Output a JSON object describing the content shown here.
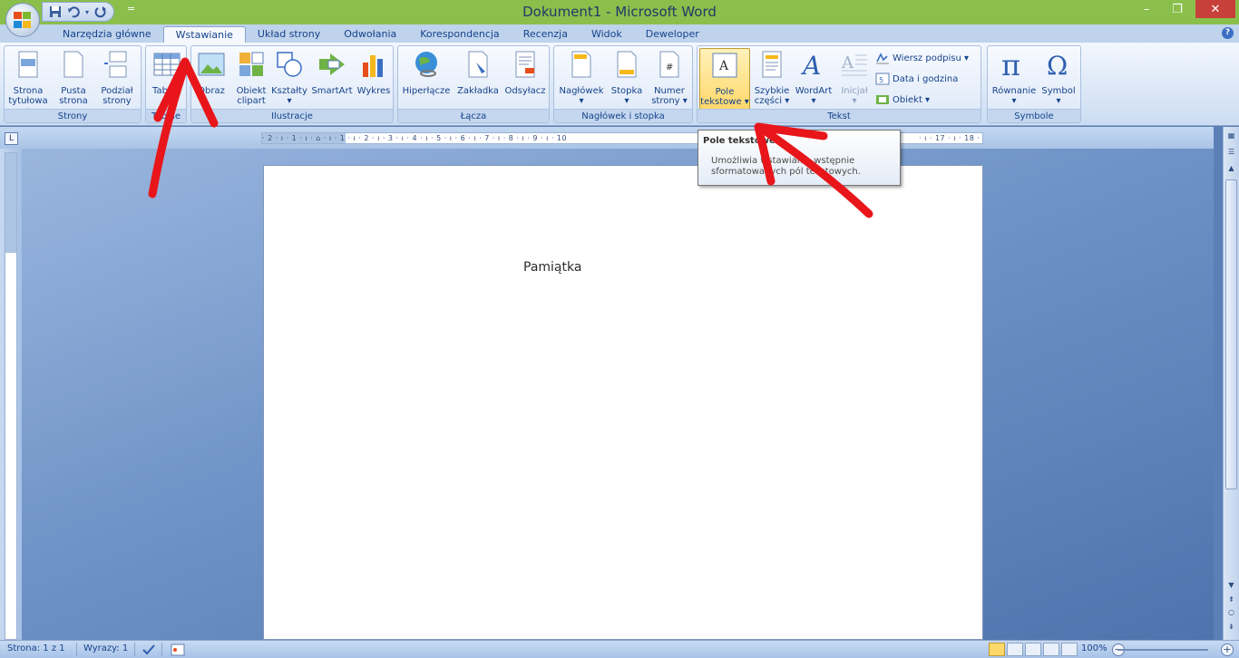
{
  "window": {
    "title": "Dokument1 - Microsoft Word",
    "qat_more": "="
  },
  "tabs": [
    {
      "label": "Narzędzia główne"
    },
    {
      "label": "Wstawianie"
    },
    {
      "label": "Układ strony"
    },
    {
      "label": "Odwołania"
    },
    {
      "label": "Korespondencja"
    },
    {
      "label": "Recenzja"
    },
    {
      "label": "Widok"
    },
    {
      "label": "Deweloper"
    }
  ],
  "ribbon": {
    "strony": {
      "label": "Strony",
      "buttons": [
        {
          "line1": "Strona",
          "line2": "tytułowa ▾"
        },
        {
          "line1": "Pusta",
          "line2": "strona"
        },
        {
          "line1": "Podział",
          "line2": "strony"
        }
      ]
    },
    "tabele": {
      "label": "Tabele",
      "button": {
        "line1": "Tabela",
        "line2": "▾"
      }
    },
    "ilustracje": {
      "label": "Ilustracje",
      "buttons": [
        {
          "line1": "Obraz",
          "line2": ""
        },
        {
          "line1": "Obiekt",
          "line2": "clipart"
        },
        {
          "line1": "Kształty",
          "line2": "▾"
        },
        {
          "line1": "SmartArt",
          "line2": ""
        },
        {
          "line1": "Wykres",
          "line2": ""
        }
      ]
    },
    "lacza": {
      "label": "Łącza",
      "buttons": [
        {
          "line1": "Hiperłącze"
        },
        {
          "line1": "Zakładka"
        },
        {
          "line1": "Odsyłacz"
        }
      ]
    },
    "naglowek": {
      "label": "Nagłówek i stopka",
      "buttons": [
        {
          "line1": "Nagłówek",
          "line2": "▾"
        },
        {
          "line1": "Stopka",
          "line2": "▾"
        },
        {
          "line1": "Numer",
          "line2": "strony ▾"
        }
      ]
    },
    "tekst": {
      "label": "Tekst",
      "buttons": [
        {
          "line1": "Pole",
          "line2": "tekstowe ▾"
        },
        {
          "line1": "Szybkie",
          "line2": "części ▾"
        },
        {
          "line1": "WordArt",
          "line2": "▾"
        },
        {
          "line1": "Inicjał",
          "line2": "▾"
        }
      ],
      "small": [
        {
          "label": "Wiersz podpisu ▾"
        },
        {
          "label": "Data i godzina"
        },
        {
          "label": "Obiekt ▾"
        }
      ]
    },
    "symbole": {
      "label": "Symbole",
      "buttons": [
        {
          "line1": "Równanie",
          "line2": "▾"
        },
        {
          "line1": "Symbol",
          "line2": "▾"
        }
      ]
    }
  },
  "ruler": {
    "ticks": "· 2 · ı · 1 · ı · ⌂ · ı · 1 · ı · 2 · ı · 3 · ı · 4 · ı · 5 · ı · 6 · ı · 7 · ı · 8 · ı · 9 · ı · 10",
    "ticks_right": "· ı · 17 · ı · 18 ·",
    "corner": "L"
  },
  "tooltip": {
    "title": "Pole tekstowe",
    "body": "Umożliwia wstawianie wstępnie sformatowanych pól tekstowych."
  },
  "document": {
    "text": "Pamiątka"
  },
  "statusbar": {
    "page": "Strona: 1 z 1",
    "words": "Wyrazy: 1",
    "zoom": "100%"
  },
  "colors": {
    "title_bar": "#8bbf4c",
    "annotation_arrow": "#e8161a",
    "active_button": "#ffd86b"
  }
}
